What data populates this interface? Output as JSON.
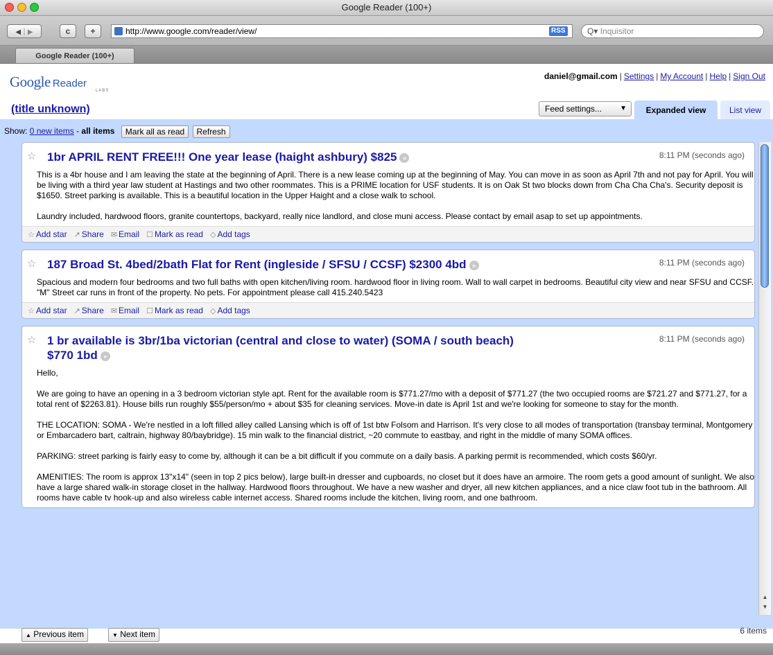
{
  "window": {
    "title": "Google Reader (100+)"
  },
  "browser": {
    "back_icon": "back-arrow-icon",
    "forward_icon": "forward-arrow-icon",
    "reload_label": "c",
    "add_label": "+",
    "url": "http://www.google.com/reader/view/",
    "rss_label": "RSS",
    "search_placeholder": "Inquisitor",
    "tab_label": "Google Reader (100+)"
  },
  "logo": {
    "google": "Google",
    "reader": "Reader",
    "labs": "LABS"
  },
  "userbar": {
    "email": "daniel@gmail.com",
    "links": [
      "Settings",
      "My Account",
      "Help",
      "Sign Out"
    ]
  },
  "feed": {
    "title": "(title unknown)",
    "settings_label": "Feed settings...",
    "view_tabs": [
      "Expanded view",
      "List view"
    ]
  },
  "showbar": {
    "show_label": "Show:",
    "new_items": "0 new items",
    "dash": "-",
    "all_items": "all items",
    "mark_all_read": "Mark all as read",
    "refresh": "Refresh"
  },
  "entries": [
    {
      "title": "1br APRIL RENT FREE!!! One year lease (haight ashbury) $825",
      "date": "8:11 PM (seconds ago)",
      "paragraphs": [
        "This is a 4br house and I am leaving the state at the beginning of April. There is a new lease coming up at the beginning of May. You can move in as soon as April 7th and not pay for April. You will be living with a third year law student at Hastings and two other roommates. This is a PRIME location for USF students. It is on Oak St two blocks down from Cha Cha Cha's. Security deposit is $1650. Street parking is available. This is a beautiful location in the Upper Haight and a close walk to school.",
        "Laundry included, hardwood floors, granite countertops, backyard, really nice landlord, and close muni access. Please contact by email asap to set up appointments."
      ],
      "has_actions": true
    },
    {
      "title": "187 Broad St. 4bed/2bath Flat for Rent (ingleside / SFSU / CCSF) $2300 4bd",
      "date": "8:11 PM (seconds ago)",
      "paragraphs": [
        "Spacious and modern four bedrooms and two full baths with open kitchen/living room. hardwood floor in living room. Wall to wall carpet in bedrooms. Beautiful city view and near SFSU and CCSF. \"M\" Street car runs in front of the property. No pets. For appointment please call 415.240.5423"
      ],
      "has_actions": true
    },
    {
      "title": "1 br available is 3br/1ba victorian (central and close to water) (SOMA / south beach) $770 1bd",
      "date": "8:11 PM (seconds ago)",
      "paragraphs": [
        "Hello,",
        "We are going to have an opening in a 3 bedroom victorian style apt. Rent for the available room is $771.27/mo with a deposit of $771.27 (the two occupied rooms are $721.27 and $771.27, for a total rent of $2263.81). House bills run roughly $55/person/mo + about $35 for cleaning services. Move-in date is April 1st and we're looking for someone to stay for the month.",
        "THE LOCATION: SOMA - We're nestled in a loft filled alley called Lansing which is off of 1st btw Folsom and Harrison. It's very close to all modes of transportation (transbay terminal, Montgomery or Embarcadero bart, caltrain, highway 80/baybridge). 15 min walk to the financial district, ~20 commute to eastbay, and right in the middle of many SOMA offices.",
        "PARKING: street parking is fairly easy to come by, although it can be a bit difficult if you commute on a daily basis. A parking permit is recommended, which costs $60/yr.",
        "AMENITIES: The room is approx 13\"x14\" (seen in top 2 pics below), large built-in dresser and cupboards, no closet but it does have an armoire. The room gets a good amount of sunlight. We also have a large shared walk-in storage closet in the hallway. Hardwood floors throughout. We have a new washer and dryer, all new kitchen appliances, and a nice claw foot tub in the bathroom. All rooms have cable tv hook-up and also wireless cable internet access. Shared rooms include the kitchen, living room, and one bathroom."
      ],
      "has_actions": false
    }
  ],
  "entry_actions": [
    {
      "icon": "star-outline-icon",
      "label": "Add star"
    },
    {
      "icon": "share-icon",
      "label": "Share"
    },
    {
      "icon": "email-icon",
      "label": "Email"
    },
    {
      "icon": "checkbox-icon",
      "label": "Mark as read"
    },
    {
      "icon": "tag-icon",
      "label": "Add tags"
    }
  ],
  "footer": {
    "prev_label": "Previous item",
    "next_label": "Next item",
    "item_count": "6 items"
  },
  "colors": {
    "accent_blue": "#c3d9ff",
    "link": "#1a1aa6",
    "rss_badge": "#3f77d8"
  }
}
